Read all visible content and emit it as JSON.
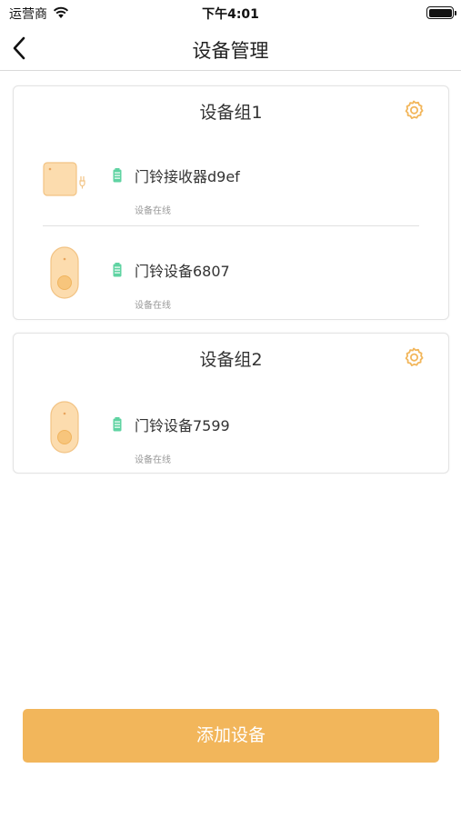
{
  "status_bar": {
    "carrier": "运营商",
    "time": "下午4:01"
  },
  "nav": {
    "title": "设备管理",
    "back_icon": "chevron-left-icon"
  },
  "groups": [
    {
      "title": "设备组1",
      "settings_icon": "gear-icon",
      "devices": [
        {
          "name": "门铃接收器d9ef",
          "status": "设备在线",
          "icon": "doorbell-receiver-icon"
        },
        {
          "name": "门铃设备6807",
          "status": "设备在线",
          "icon": "doorbell-device-icon"
        }
      ]
    },
    {
      "title": "设备组2",
      "settings_icon": "gear-icon",
      "devices": [
        {
          "name": "门铃设备7599",
          "status": "设备在线",
          "icon": "doorbell-device-icon"
        }
      ]
    }
  ],
  "add_button": {
    "label": "添加设备"
  },
  "colors": {
    "accent": "#f2b65b",
    "device_fill": "#fcdcae",
    "device_stroke": "#f2c384",
    "battery_green": "#5fd3a2"
  }
}
